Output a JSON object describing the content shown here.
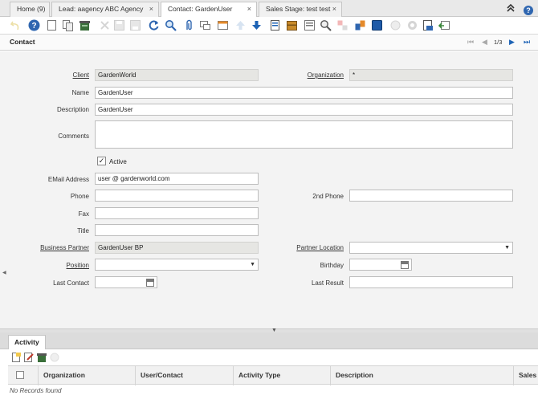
{
  "tabs": [
    {
      "label": "Home (9)",
      "closable": false,
      "active": false
    },
    {
      "label": "Lead: aagency ABC Agency",
      "closable": true,
      "active": false
    },
    {
      "label": "Contact: GardenUser",
      "closable": true,
      "active": true
    },
    {
      "label": "Sales Stage: test test",
      "closable": true,
      "active": false
    }
  ],
  "tab_close_glyph": "×",
  "window_icons": {
    "collapse": "double-chevron-up-icon",
    "help": "help-circle-icon",
    "help_glyph": "?",
    "collapse_glyph": "⌃"
  },
  "toolbar_icons": [
    "undo-icon",
    "help-icon",
    "new-record-icon",
    "copy-record-icon",
    "delete-icon",
    "delete-selection-icon",
    "save-icon",
    "save-and-new-icon",
    "refresh-icon",
    "find-icon",
    "attachment-icon",
    "chat-icon",
    "grid-toggle-icon",
    "previous-record-icon",
    "next-record-icon",
    "report-icon",
    "archive-icon",
    "zoom-across-icon",
    "request-icon",
    "product-info-icon",
    "workflow-icon",
    "process-icon",
    "customize-icon",
    "export-icon",
    "import-icon"
  ],
  "header": {
    "title": "Contact",
    "counter": "1/3",
    "nav_first": "⏮",
    "nav_prev": "◀",
    "nav_next": "▶",
    "nav_last": "⏭"
  },
  "form": {
    "client_label": "Client",
    "client_value": "GardenWorld",
    "organization_label": "Organization",
    "organization_value": "*",
    "name_label": "Name",
    "name_value": "GardenUser",
    "description_label": "Description",
    "description_value": "GardenUser",
    "comments_label": "Comments",
    "comments_value": "",
    "active_label": "Active",
    "active_checked": "✓",
    "email_label": "EMail Address",
    "email_value": "user @ gardenworld.com",
    "phone_label": "Phone",
    "phone_value": "",
    "phone2_label": "2nd Phone",
    "phone2_value": "",
    "fax_label": "Fax",
    "fax_value": "",
    "title_label": "Title",
    "title_value": "",
    "bpartner_label": "Business Partner",
    "bpartner_value": "GardenUser BP",
    "partner_location_label": "Partner Location",
    "partner_location_value": "",
    "position_label": "Position",
    "position_value": "",
    "birthday_label": "Birthday",
    "birthday_value": "",
    "last_contact_label": "Last Contact",
    "last_contact_value": "",
    "last_result_label": "Last Result",
    "last_result_value": "",
    "dropdown_glyph": "▼"
  },
  "detail": {
    "tab_label": "Activity",
    "toolbar_icons": [
      "new-record-icon",
      "edit-record-icon",
      "delete-icon",
      "info-icon"
    ],
    "columns": [
      "Organization",
      "User/Contact",
      "Activity Type",
      "Description",
      "Sales"
    ],
    "empty_text": "No Records found"
  },
  "colors": {
    "accent": "#1e63b5",
    "form_bg": "#f3f3f3",
    "readonly_bg": "#e6e6e3"
  }
}
